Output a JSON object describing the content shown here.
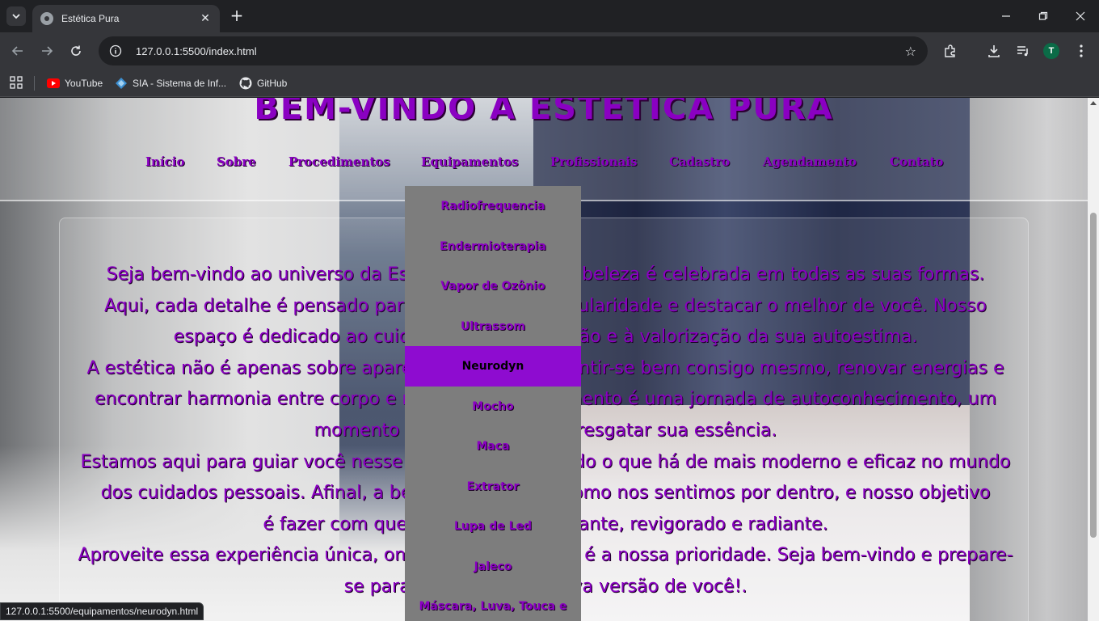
{
  "browser": {
    "tab_title": "Estética Pura",
    "url": "127.0.0.1:5500/index.html",
    "profile_initial": "T",
    "status_url": "127.0.0.1:5500/equipamentos/neurodyn.html",
    "bookmarks": [
      {
        "label": "YouTube",
        "icon": "youtube-icon"
      },
      {
        "label": "SIA - Sistema de Inf...",
        "icon": "sia-icon"
      },
      {
        "label": "GitHub",
        "icon": "github-icon"
      }
    ]
  },
  "page": {
    "title": "BEM-VINDO A ESTÉTICA PURA",
    "nav": [
      "Início",
      "Sobre",
      "Procedimentos",
      "Equipamentos",
      "Profissionais",
      "Cadastro",
      "Agendamento",
      "Contato"
    ],
    "dropdown": [
      "Radiofrequencia",
      "Endermioterapia",
      "Vapor de Ozônio",
      "Ultrassom",
      "Neurodyn",
      "Mocho",
      "Maca",
      "Extrator",
      "Lupa de Led",
      "Jaleco",
      "Máscara, Luva, Touca e"
    ],
    "dropdown_active": "Neurodyn",
    "intro_lines": [
      "Seja bem-vindo ao universo da Estética Pura, onde a beleza é celebrada em todas as suas formas.",
      "Aqui, cada detalhe é pensado para realçar a sua singularidade e destacar o melhor de você. Nosso",
      "espaço é dedicado ao cuidado, à transformação e à valorização da sua autoestima.",
      "A estética não é apenas sobre aparência, mas sobre sentir-se bem consigo mesmo, renovar energias e",
      "encontrar harmonia entre corpo e mente. Cada tratamento é uma jornada de autoconhecimento, um",
      "momento para cuidar de si e resgatar sua essência.",
      "Estamos aqui para guiar você nesse caminho, oferecendo o que há de mais moderno e eficaz no mundo",
      "dos cuidados pessoais. Afinal, a beleza começa em como nos sentimos por dentro, e nosso objetivo",
      "é fazer com que você se sinta confiante, revigorado e radiante.",
      "Aproveite essa experiência única, onde o seu bem-estar é a nossa prioridade. Seja bem-vindo e prepare-",
      "se para descobrir uma nova versão de você!."
    ]
  },
  "colors": {
    "accent": "#8a00c2",
    "dropdown_bg": "#7d7d7d",
    "dropdown_active": "#8e0cd0"
  }
}
